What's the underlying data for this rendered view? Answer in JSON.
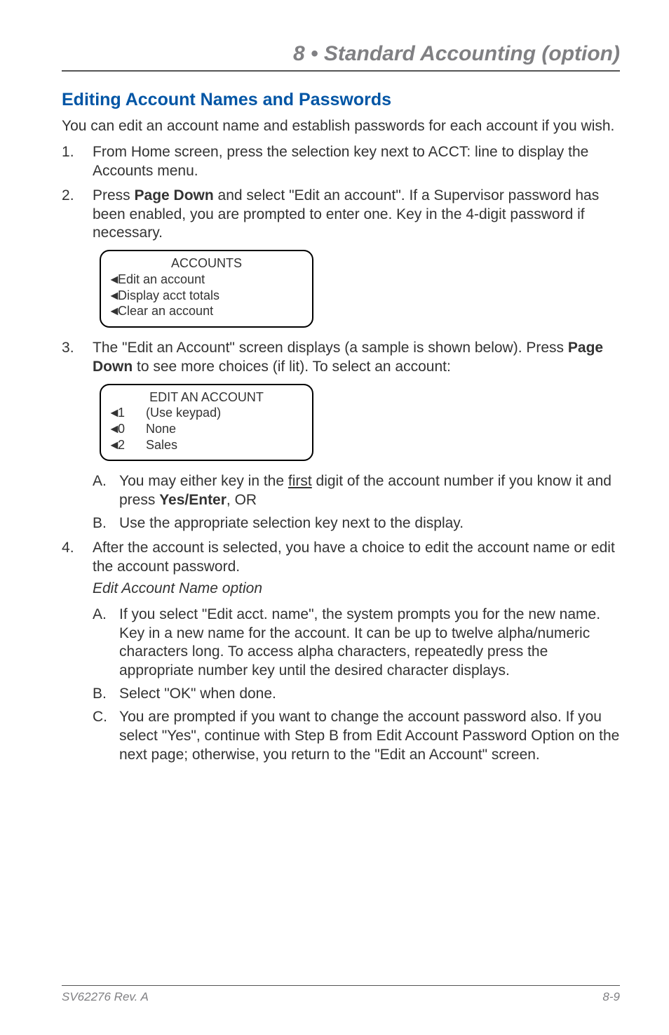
{
  "header": {
    "chapter": "8 • Standard Accounting (option)"
  },
  "section": {
    "title": "Editing Account Names and Passwords",
    "intro": "You can edit an account name and establish passwords for each account if you wish."
  },
  "steps": {
    "s1": "From Home screen, press the selection key next to ACCT: line to display the Accounts menu.",
    "s2a": "Press ",
    "s2b": "Page Down",
    "s2c": " and select \"Edit an account\". If a Supervisor password has been enabled, you are prompted to enter one. Key in the 4-digit password if necessary.",
    "s3a": "The \"Edit an Account\" screen displays (a sample is shown below). Press ",
    "s3b": "Page Down",
    "s3c": " to see more choices (if lit). To select an account:",
    "s3A_a": "You may either key in the ",
    "s3A_first": "first",
    "s3A_b": " digit of the account number if you know it and press ",
    "s3A_c": "Yes/Enter",
    "s3A_d": ",  OR",
    "s3B": "Use the appropriate selection key next to the display.",
    "s4": "After the account is selected, you have a choice to edit the account name or edit the account password.",
    "s4sub": "Edit Account Name option",
    "s4A": "If you select \"Edit acct. name\", the system prompts you for the new name. Key in a new name for the account. It can be up to twelve alpha/numeric characters long. To access alpha characters, repeatedly press the appropriate number key until the desired character displays.",
    "s4B": "Select \"OK\" when done.",
    "s4C": "You are prompted if you want to change the account password also. If you select \"Yes\", continue with Step B from Edit Account Password Option on the next page; otherwise, you return to the \"Edit an Account\" screen."
  },
  "lcd1": {
    "title": "ACCOUNTS",
    "r1": "Edit an account",
    "r2": "Display acct totals",
    "r3": "Clear an account"
  },
  "lcd2": {
    "title": "EDIT AN ACCOUNT",
    "r1n": "1",
    "r1t": "(Use keypad)",
    "r2n": "0",
    "r2t": "None",
    "r3n": "2",
    "r3t": "Sales"
  },
  "footer": {
    "left": "SV62276 Rev. A",
    "right": "8-9"
  }
}
